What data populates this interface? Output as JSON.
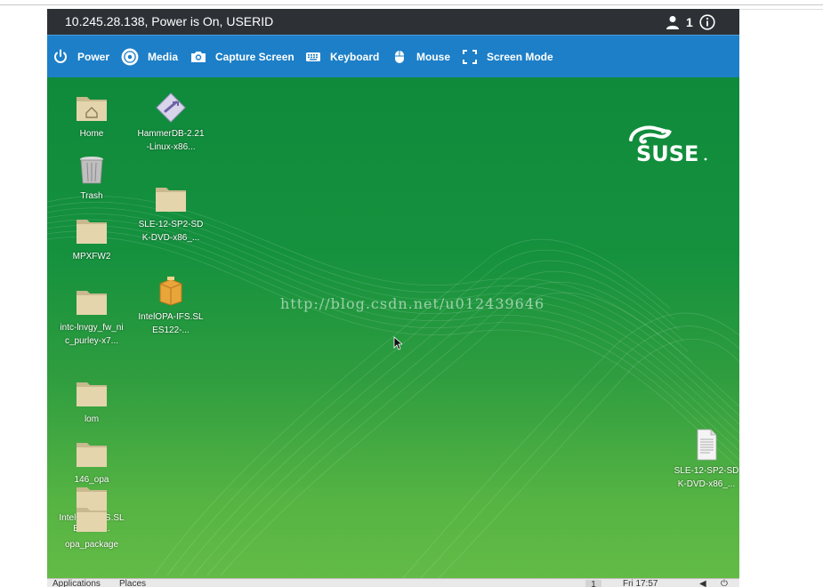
{
  "window": {
    "title": "10.245.28.138, Power is On, USERID",
    "user_count": "1"
  },
  "toolbar": {
    "items": [
      {
        "label": "Power",
        "icon": "power-icon"
      },
      {
        "label": "Media",
        "icon": "media-disc-icon"
      },
      {
        "label": "Capture Screen",
        "icon": "camera-icon"
      },
      {
        "label": "Keyboard",
        "icon": "keyboard-icon"
      },
      {
        "label": "Mouse",
        "icon": "mouse-icon"
      },
      {
        "label": "Screen Mode",
        "icon": "fullscreen-icon"
      }
    ]
  },
  "desktop": {
    "icons": [
      {
        "label": "Home",
        "type": "home-folder"
      },
      {
        "label": "Trash",
        "type": "trash"
      },
      {
        "label": "MPXFW2",
        "type": "folder"
      },
      {
        "label": "intc-lnvgy_fw_nic_purley-x7...",
        "type": "folder"
      },
      {
        "label": "lom",
        "type": "folder"
      },
      {
        "label": "146_opa",
        "type": "folder"
      },
      {
        "label": "IntelOPA-IFS.SLES122-...",
        "type": "folder"
      },
      {
        "label": "opa_package",
        "type": "folder"
      },
      {
        "label": "HammerDB-2.21-Linux-x86...",
        "type": "installer"
      },
      {
        "label": "SLE-12-SP2-SDK-DVD-x86_...",
        "type": "folder"
      },
      {
        "label": "IntelOPA-IFS.SLES122-...",
        "type": "package"
      },
      {
        "label": "SLE-12-SP2-SDK-DVD-x86_...",
        "type": "document"
      }
    ],
    "brand": "SUSE",
    "watermark": "http://blog.csdn.net/u012439646"
  },
  "taskbar": {
    "applications": "Applications",
    "places": "Places",
    "workspace": "1",
    "clock": "Fri 17:57"
  },
  "colors": {
    "titlebar": "#2d3136",
    "toolbar": "#1d7fc7",
    "desktop_green": "#15913e"
  }
}
